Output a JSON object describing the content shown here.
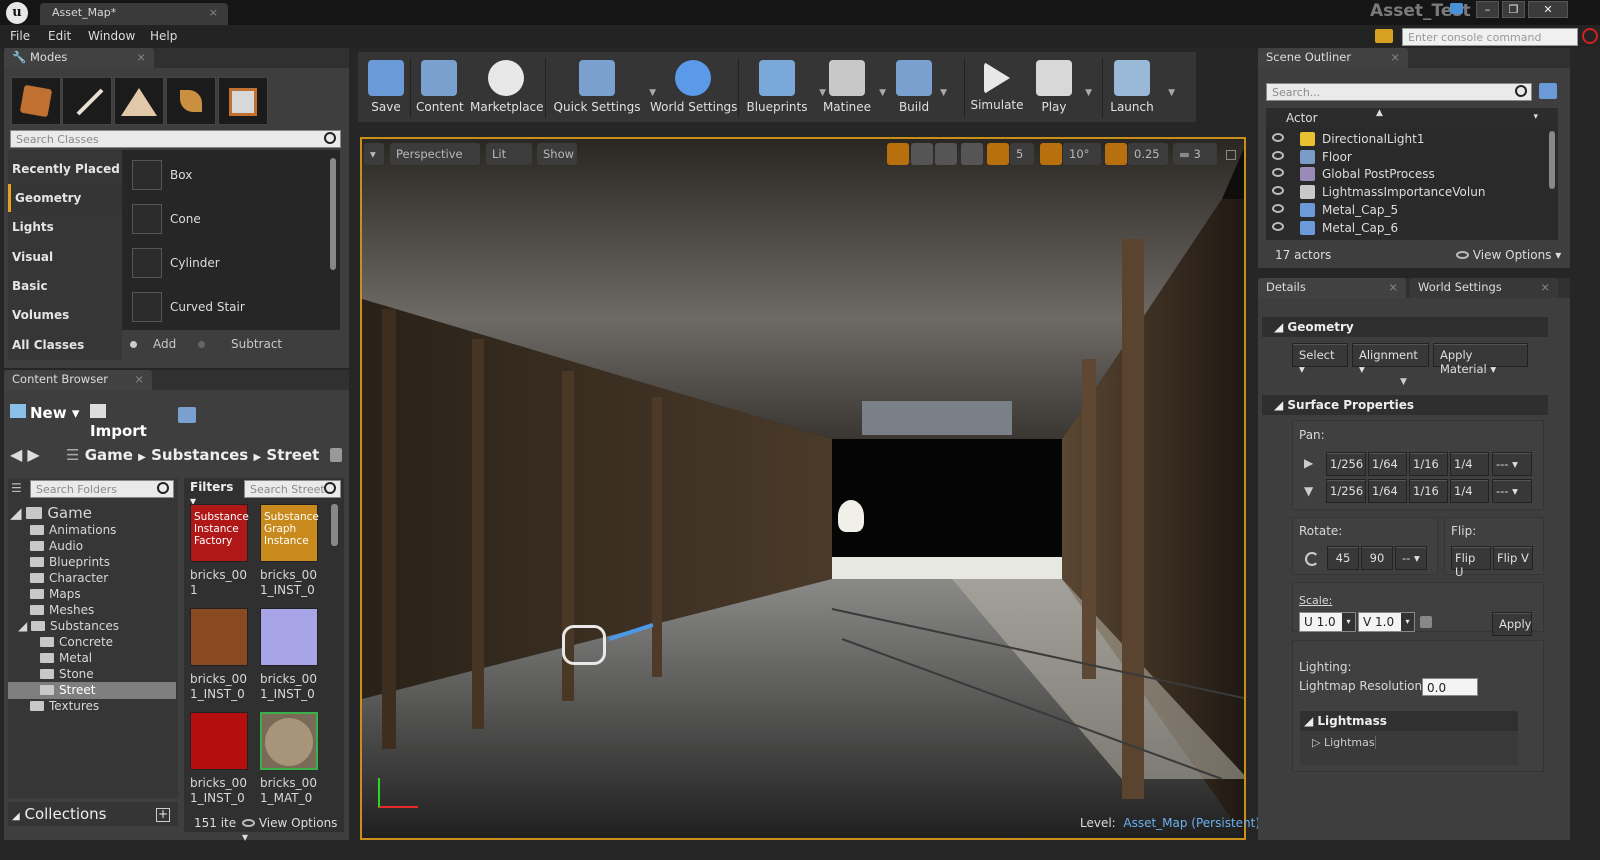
{
  "window": {
    "doc_tab": "Asset_Map*",
    "project": "Asset_Test",
    "close_glyph": "×"
  },
  "menu": [
    "File",
    "Edit",
    "Window",
    "Help"
  ],
  "console": {
    "placeholder": "Enter console command"
  },
  "modes": {
    "tab": "Modes",
    "search_placeholder": "Search Classes",
    "categories": [
      "Recently Placed",
      "Geometry",
      "Lights",
      "Visual",
      "Basic",
      "Volumes",
      "All Classes"
    ],
    "selected_category": "Geometry",
    "items": [
      "Box",
      "Cone",
      "Cylinder",
      "Curved Stair"
    ],
    "add_label": "Add",
    "subtract_label": "Subtract"
  },
  "toolbar": [
    "Save",
    "Content",
    "Marketplace",
    "Quick Settings",
    "World Settings",
    "Blueprints",
    "Matinee",
    "Build",
    "Simulate",
    "Play",
    "Launch"
  ],
  "viewport": {
    "perspective": "Perspective",
    "lit": "Lit",
    "show": "Show",
    "grid_snap": "5",
    "rot_snap": "10°",
    "scale_snap": "0.25",
    "cam_speed": "3",
    "level_label": "Level:",
    "level_name": "Asset_Map (Persistent)"
  },
  "content_browser": {
    "tab": "Content Browser",
    "new_label": "New",
    "import_label": "Import",
    "path": [
      "Game",
      "Substances",
      "Street"
    ],
    "search_folders": "Search Folders",
    "filters": "Filters",
    "search_assets": "Search Street",
    "tree": {
      "root": "Game",
      "children": [
        "Animations",
        "Audio",
        "Blueprints",
        "Character",
        "Maps",
        "Meshes",
        "Substances"
      ],
      "sub_children": [
        "Concrete",
        "Metal",
        "Stone",
        "Street"
      ],
      "last": "Textures",
      "selected": "Street"
    },
    "assets": [
      {
        "label1": "bricks_00",
        "label2": "1",
        "thumb_text": "Substance Instance Factory",
        "color": "#b01818"
      },
      {
        "label1": "bricks_00",
        "label2": "1_INST_0",
        "thumb_text": "Substance Graph Instance",
        "color": "#c88a1c"
      },
      {
        "label1": "bricks_00",
        "label2": "1_INST_0",
        "thumb_text": "",
        "color": "#8a4a22"
      },
      {
        "label1": "bricks_00",
        "label2": "1_INST_0",
        "thumb_text": "",
        "color": "#a8a4e8"
      },
      {
        "label1": "bricks_00",
        "label2": "1_INST_0",
        "thumb_text": "",
        "color": "#b40e0e"
      },
      {
        "label1": "bricks_00",
        "label2": "1_MAT_0",
        "thumb_text": "",
        "color": "#7a6a58"
      }
    ],
    "collections": "Collections",
    "count": "151 ite",
    "view_options": "View Options"
  },
  "outliner": {
    "tab": "Scene Outliner",
    "search_placeholder": "Search...",
    "col_actor": "Actor",
    "rows": [
      "DirectionalLight1",
      "Floor",
      "Global PostProcess",
      "LightmassImportanceVolun",
      "Metal_Cap_5",
      "Metal_Cap_6"
    ],
    "count": "17 actors",
    "view_options": "View Options"
  },
  "details": {
    "tab_details": "Details",
    "tab_world": "World Settings",
    "geometry_section": "Geometry",
    "select": "Select",
    "alignment": "Alignment",
    "apply_material": "Apply Material",
    "surface_section": "Surface Properties",
    "pan_label": "Pan:",
    "pan_values": [
      "1/256",
      "1/64",
      "1/16",
      "1/4",
      "---"
    ],
    "rotate_label": "Rotate:",
    "rotate_values": [
      "45",
      "90",
      "--"
    ],
    "flip_label": "Flip:",
    "flip_u": "Flip U",
    "flip_v": "Flip V",
    "scale_label": "Scale:",
    "scale_u": "U  1.0",
    "scale_v": "V  1.0",
    "apply": "Apply",
    "lighting_label": "Lighting:",
    "lightmap_res_label": "Lightmap Resolution:",
    "lightmap_res": "0.0",
    "lightmass_section": "Lightmass",
    "lightmass_item": "Lightmass"
  }
}
